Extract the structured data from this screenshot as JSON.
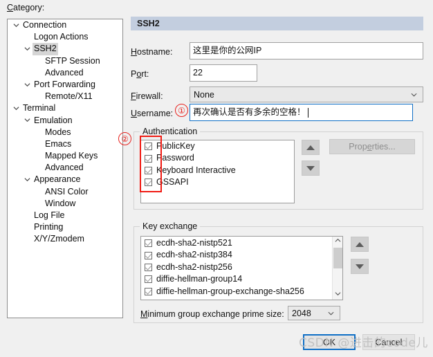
{
  "category": {
    "label": "Category:",
    "accel": "C"
  },
  "tree": {
    "items": [
      {
        "label": "Connection",
        "indent": 0,
        "twisty": "v",
        "selected": false
      },
      {
        "label": "Logon Actions",
        "indent": 1,
        "twisty": "",
        "selected": false
      },
      {
        "label": "SSH2",
        "indent": 1,
        "twisty": "v",
        "selected": true
      },
      {
        "label": "SFTP Session",
        "indent": 2,
        "twisty": "",
        "selected": false
      },
      {
        "label": "Advanced",
        "indent": 2,
        "twisty": "",
        "selected": false
      },
      {
        "label": "Port Forwarding",
        "indent": 1,
        "twisty": "v",
        "selected": false
      },
      {
        "label": "Remote/X11",
        "indent": 2,
        "twisty": "",
        "selected": false
      },
      {
        "label": "Terminal",
        "indent": 0,
        "twisty": "v",
        "selected": false
      },
      {
        "label": "Emulation",
        "indent": 1,
        "twisty": "v",
        "selected": false
      },
      {
        "label": "Modes",
        "indent": 2,
        "twisty": "",
        "selected": false
      },
      {
        "label": "Emacs",
        "indent": 2,
        "twisty": "",
        "selected": false
      },
      {
        "label": "Mapped Keys",
        "indent": 2,
        "twisty": "",
        "selected": false
      },
      {
        "label": "Advanced",
        "indent": 2,
        "twisty": "",
        "selected": false
      },
      {
        "label": "Appearance",
        "indent": 1,
        "twisty": "v",
        "selected": false
      },
      {
        "label": "ANSI Color",
        "indent": 2,
        "twisty": "",
        "selected": false
      },
      {
        "label": "Window",
        "indent": 2,
        "twisty": "",
        "selected": false
      },
      {
        "label": "Log File",
        "indent": 1,
        "twisty": "",
        "selected": false
      },
      {
        "label": "Printing",
        "indent": 1,
        "twisty": "",
        "selected": false
      },
      {
        "label": "X/Y/Zmodem",
        "indent": 1,
        "twisty": "",
        "selected": false
      }
    ]
  },
  "panel": {
    "title": "SSH2",
    "fields": {
      "hostname_label": "Hostname:",
      "hostname_value": "这里是你的公网IP",
      "port_label": "Port:",
      "port_value": "22",
      "firewall_label": "Firewall:",
      "firewall_value": "None",
      "username_label": "Username:",
      "username_value": "再次确认是否有多余的空格！"
    },
    "authentication": {
      "title": "Authentication",
      "items": [
        {
          "label": "PublicKey",
          "checked": true
        },
        {
          "label": "Password",
          "checked": true
        },
        {
          "label": "Keyboard Interactive",
          "checked": true
        },
        {
          "label": "GSSAPI",
          "checked": true
        }
      ],
      "properties_button": "Properties...",
      "move_up": "▲",
      "move_down": "▼"
    },
    "key_exchange": {
      "title": "Key exchange",
      "items": [
        {
          "label": "ecdh-sha2-nistp521",
          "checked": true
        },
        {
          "label": "ecdh-sha2-nistp384",
          "checked": true
        },
        {
          "label": "ecdh-sha2-nistp256",
          "checked": true
        },
        {
          "label": "diffie-hellman-group14",
          "checked": true
        },
        {
          "label": "diffie-hellman-group-exchange-sha256",
          "checked": true
        }
      ],
      "min_prime_label": "Minimum group exchange prime size:",
      "min_prime_value": "2048",
      "move_up": "▲",
      "move_down": "▼"
    }
  },
  "footer": {
    "ok_label": "OK",
    "cancel_label": "Cancel"
  },
  "annotations": {
    "marker_one": "①",
    "marker_two": "②",
    "highlight_color": "#f01a12"
  },
  "watermark": {
    "text": "CSDN @进击的code儿"
  }
}
